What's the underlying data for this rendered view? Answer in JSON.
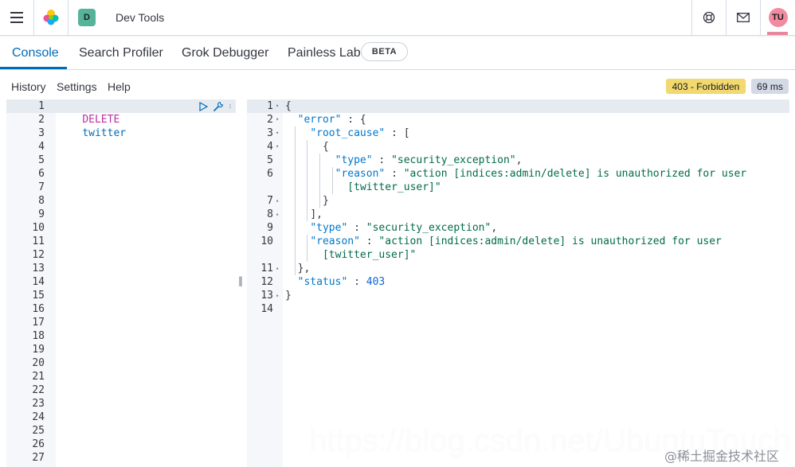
{
  "header": {
    "space_initial": "D",
    "app_title": "Dev Tools",
    "avatar_initials": "TU",
    "colors": {
      "space": "#54b399",
      "avatar": "#f08ba0",
      "accent": "#006bb8"
    }
  },
  "tabs": [
    {
      "label": "Console",
      "active": true
    },
    {
      "label": "Search Profiler",
      "active": false
    },
    {
      "label": "Grok Debugger",
      "active": false
    },
    {
      "label": "Painless Lab",
      "active": false
    }
  ],
  "beta_badge": "BETA",
  "toolbar": {
    "history": "History",
    "settings": "Settings",
    "help": "Help",
    "status_code": "403 - Forbidden",
    "status_time": "69 ms"
  },
  "request": {
    "method": "DELETE",
    "index": "twitter",
    "line_numbers": [
      "1",
      "2",
      "3",
      "4",
      "5",
      "6",
      "7",
      "8",
      "9",
      "10",
      "11",
      "12",
      "13",
      "14",
      "15",
      "16",
      "17",
      "18",
      "19",
      "20",
      "21",
      "22",
      "23",
      "24",
      "25",
      "26",
      "27"
    ]
  },
  "response": {
    "line_numbers": [
      "1",
      "2",
      "3",
      "4",
      "5",
      "6",
      "7",
      "8",
      "9",
      "10",
      "11",
      "12",
      "13",
      "14"
    ],
    "lines": [
      {
        "parts": [
          [
            "punc",
            "{"
          ]
        ]
      },
      {
        "parts": [
          [
            "key",
            "\"error\""
          ],
          [
            "punc",
            " : {"
          ]
        ]
      },
      {
        "parts": [
          [
            "key",
            "\"root_cause\""
          ],
          [
            "punc",
            " : ["
          ]
        ]
      },
      {
        "parts": [
          [
            "punc",
            "{"
          ]
        ]
      },
      {
        "parts": [
          [
            "key",
            "\"type\""
          ],
          [
            "punc",
            " : "
          ],
          [
            "str",
            "\"security_exception\""
          ],
          [
            "punc",
            ","
          ]
        ]
      },
      {
        "parts": [
          [
            "key",
            "\"reason\""
          ],
          [
            "punc",
            " : "
          ],
          [
            "str",
            "\"action [indices:admin/delete] is unauthorized for user"
          ]
        ]
      },
      {
        "parts": [
          [
            "str",
            "[twitter_user]\""
          ]
        ]
      },
      {
        "parts": [
          [
            "punc",
            "}"
          ]
        ]
      },
      {
        "parts": [
          [
            "punc",
            "],"
          ]
        ]
      },
      {
        "parts": [
          [
            "key",
            "\"type\""
          ],
          [
            "punc",
            " : "
          ],
          [
            "str",
            "\"security_exception\""
          ],
          [
            "punc",
            ","
          ]
        ]
      },
      {
        "parts": [
          [
            "key",
            "\"reason\""
          ],
          [
            "punc",
            " : "
          ],
          [
            "str",
            "\"action [indices:admin/delete] is unauthorized for user"
          ]
        ]
      },
      {
        "parts": [
          [
            "str",
            "[twitter_user]\""
          ]
        ]
      },
      {
        "parts": [
          [
            "punc",
            "},"
          ]
        ]
      },
      {
        "parts": [
          [
            "key",
            "\"status\""
          ],
          [
            "punc",
            " : "
          ],
          [
            "num",
            "403"
          ]
        ]
      },
      {
        "parts": [
          [
            "punc",
            "}"
          ]
        ]
      }
    ]
  },
  "watermark": "https://blog.csdn.net/UbuntuTouch",
  "watermark_credit": "@稀土掘金技术社区"
}
